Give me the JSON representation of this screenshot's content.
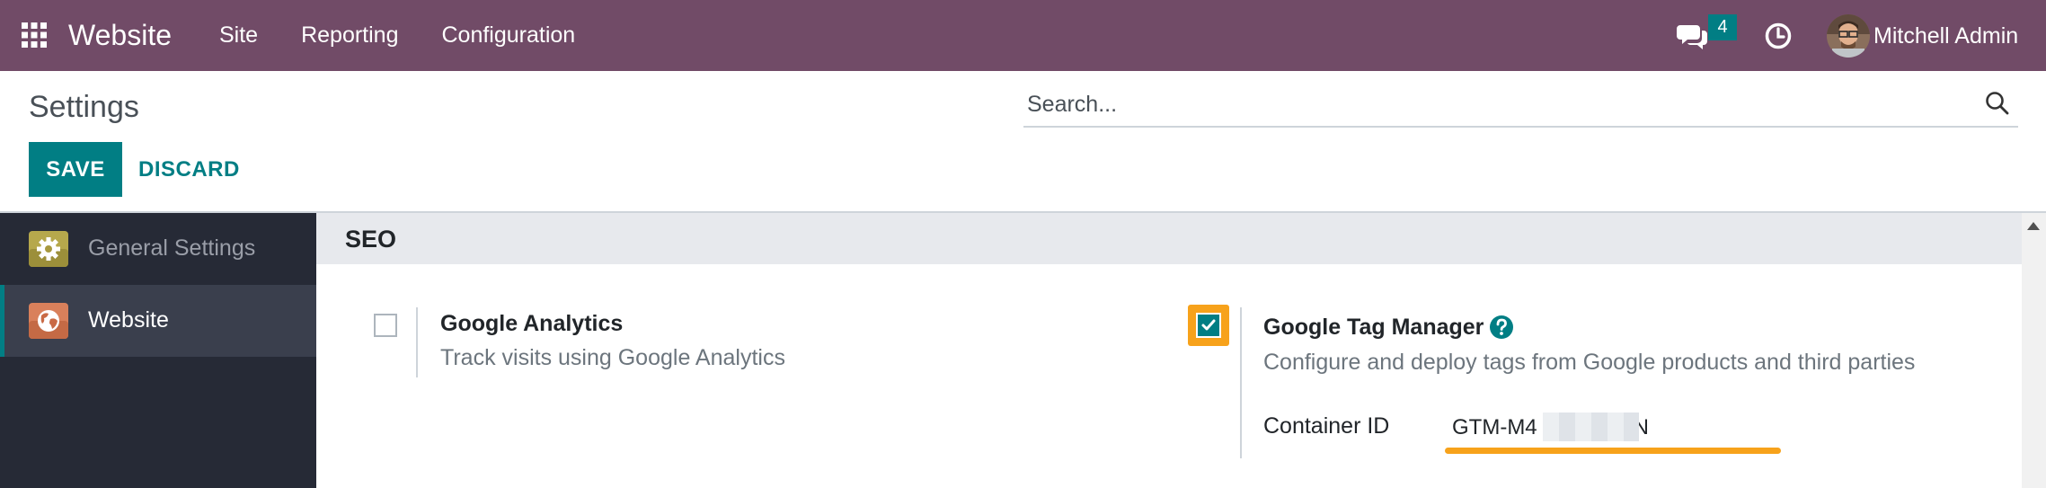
{
  "navbar": {
    "app_name": "Website",
    "menu": [
      "Site",
      "Reporting",
      "Configuration"
    ],
    "messages_count": "4",
    "user_name": "Mitchell Admin",
    "background_color": "#714b67",
    "icons": [
      "apps-grid-icon",
      "chat-icon",
      "clock-icon"
    ]
  },
  "control_panel": {
    "title": "Settings",
    "search_placeholder": "Search...",
    "save_label": "SAVE",
    "discard_label": "DISCARD",
    "accent_color": "#017e84"
  },
  "sidebar": {
    "items": [
      {
        "label": "General Settings",
        "icon": "gear-icon",
        "active": false
      },
      {
        "label": "Website",
        "icon": "globe-icon",
        "active": true
      }
    ]
  },
  "section": {
    "title": "SEO",
    "settings": [
      {
        "title": "Google Analytics",
        "description": "Track visits using Google Analytics",
        "checked": false
      },
      {
        "title": "Google Tag Manager",
        "description": "Configure and deploy tags from Google products and third parties",
        "checked": true,
        "field_label": "Container ID",
        "field_value_prefix": "GTM-M4",
        "field_value_suffix": "N",
        "field_value_redacted": true
      }
    ]
  },
  "highlight_color": "#f7a21b"
}
